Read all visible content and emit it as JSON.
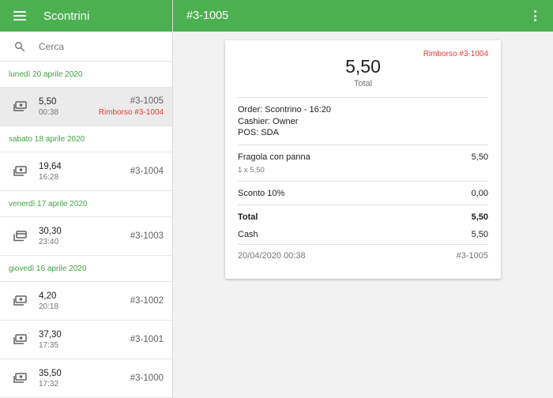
{
  "left_bar": {
    "title": "Scontrini"
  },
  "search": {
    "placeholder": "Cerca",
    "value": ""
  },
  "groups": [
    {
      "date": "lunedì 20 aprile 2020",
      "rows": [
        {
          "amount": "5,50",
          "time": "00:38",
          "number": "#3-1005",
          "refund": "Rimborso #3-1004",
          "icon": "cash-icon"
        }
      ]
    },
    {
      "date": "sabato 18 aprile 2020",
      "rows": [
        {
          "amount": "19,64",
          "time": "16:28",
          "number": "#3-1004",
          "refund": "",
          "icon": "cash-icon"
        }
      ]
    },
    {
      "date": "venerdì 17 aprile 2020",
      "rows": [
        {
          "amount": "30,30",
          "time": "23:40",
          "number": "#3-1003",
          "refund": "",
          "icon": "card-icon"
        }
      ]
    },
    {
      "date": "giovedì 16 aprile 2020",
      "rows": [
        {
          "amount": "4,20",
          "time": "20:18",
          "number": "#3-1002",
          "refund": "",
          "icon": "cash-icon"
        },
        {
          "amount": "37,30",
          "time": "17:35",
          "number": "#3-1001",
          "refund": "",
          "icon": "cash-icon"
        },
        {
          "amount": "35,50",
          "time": "17:32",
          "number": "#3-1000",
          "refund": "",
          "icon": "cash-icon"
        }
      ]
    }
  ],
  "right_bar": {
    "title": "#3-1005"
  },
  "receipt": {
    "refund_label": "Rimborso #3-1004",
    "total_amount": "5,50",
    "total_caption": "Total",
    "order": "Order: Scontrino - 16:20",
    "cashier": "Cashier: Owner",
    "pos": "POS: SDA",
    "item_name": "Fragola con panna",
    "item_price": "5,50",
    "item_qty": "1 x 5,50",
    "discount_label": "Sconto 10%",
    "discount_value": "0,00",
    "total_label": "Total",
    "total_value": "5,50",
    "payment_label": "Cash",
    "payment_value": "5,50",
    "datetime": "20/04/2020 00:38",
    "number": "#3-1005"
  },
  "colors": {
    "primary": "#4caf50",
    "date_header": "#43a047",
    "refund": "#e53935"
  }
}
